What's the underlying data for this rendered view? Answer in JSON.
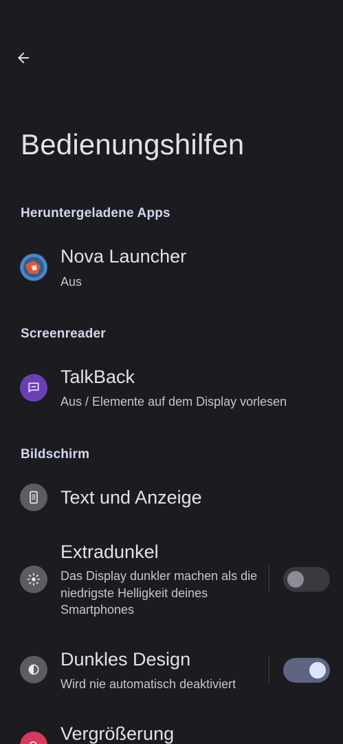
{
  "header": {
    "back_icon": "arrow-back-icon",
    "title": "Bedienungshilfen"
  },
  "sections": [
    {
      "title": "Heruntergeladene Apps",
      "items": [
        {
          "title": "Nova Launcher",
          "subtitle": "Aus",
          "icon": "nova-launcher-icon"
        }
      ]
    },
    {
      "title": "Screenreader",
      "items": [
        {
          "title": "TalkBack",
          "subtitle": "Aus / Elemente auf dem Display vorlesen",
          "icon": "chat-bubble-icon",
          "icon_color": "#6a3fb5"
        }
      ]
    },
    {
      "title": "Bildschirm",
      "items": [
        {
          "title": "Text und Anzeige",
          "icon": "phone-text-icon",
          "icon_color": "#5c5d62"
        },
        {
          "title": "Extradunkel",
          "subtitle": "Das Display dunkler machen als die niedrigste Helligkeit deines Smartphones",
          "icon": "brightness-low-icon",
          "icon_color": "#5c5d62",
          "toggle": false
        },
        {
          "title": "Dunkles Design",
          "subtitle": "Wird nie automatisch deaktiviert",
          "icon": "contrast-icon",
          "icon_color": "#5c5d62",
          "toggle": true
        },
        {
          "title": "Vergrößerung",
          "icon": "magnify-icon",
          "icon_color": "#d83a5c"
        }
      ]
    }
  ]
}
